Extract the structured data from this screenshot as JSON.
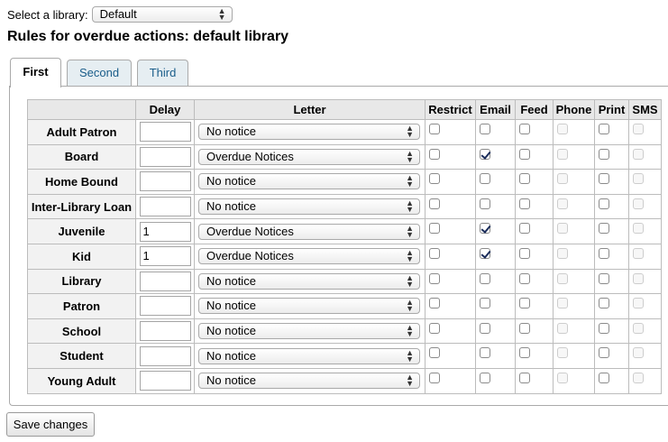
{
  "library_select": {
    "label": "Select a library:",
    "value": "Default"
  },
  "page_title": "Rules for overdue actions: default library",
  "tabs": [
    {
      "label": "First",
      "active": true
    },
    {
      "label": "Second",
      "active": false
    },
    {
      "label": "Third",
      "active": false
    }
  ],
  "table": {
    "headers": {
      "delay": "Delay",
      "letter": "Letter",
      "restrict": "Restrict",
      "email": "Email",
      "feed": "Feed",
      "phone": "Phone",
      "print": "Print",
      "sms": "SMS"
    },
    "rows": [
      {
        "category": "Adult Patron",
        "delay": "",
        "letter": "No notice",
        "restrict": false,
        "email": false,
        "feed": false,
        "phone": false,
        "print": false,
        "sms": false
      },
      {
        "category": "Board",
        "delay": "",
        "letter": "Overdue Notices",
        "restrict": false,
        "email": true,
        "feed": false,
        "phone": false,
        "print": false,
        "sms": false
      },
      {
        "category": "Home Bound",
        "delay": "",
        "letter": "No notice",
        "restrict": false,
        "email": false,
        "feed": false,
        "phone": false,
        "print": false,
        "sms": false
      },
      {
        "category": "Inter-Library Loan",
        "delay": "",
        "letter": "No notice",
        "restrict": false,
        "email": false,
        "feed": false,
        "phone": false,
        "print": false,
        "sms": false
      },
      {
        "category": "Juvenile",
        "delay": "1",
        "letter": "Overdue Notices",
        "restrict": false,
        "email": true,
        "feed": false,
        "phone": false,
        "print": false,
        "sms": false
      },
      {
        "category": "Kid",
        "delay": "1",
        "letter": "Overdue Notices",
        "restrict": false,
        "email": true,
        "feed": false,
        "phone": false,
        "print": false,
        "sms": false
      },
      {
        "category": "Library",
        "delay": "",
        "letter": "No notice",
        "restrict": false,
        "email": false,
        "feed": false,
        "phone": false,
        "print": false,
        "sms": false
      },
      {
        "category": "Patron",
        "delay": "",
        "letter": "No notice",
        "restrict": false,
        "email": false,
        "feed": false,
        "phone": false,
        "print": false,
        "sms": false
      },
      {
        "category": "School",
        "delay": "",
        "letter": "No notice",
        "restrict": false,
        "email": false,
        "feed": false,
        "phone": false,
        "print": false,
        "sms": false
      },
      {
        "category": "Student",
        "delay": "",
        "letter": "No notice",
        "restrict": false,
        "email": false,
        "feed": false,
        "phone": false,
        "print": false,
        "sms": false
      },
      {
        "category": "Young Adult",
        "delay": "",
        "letter": "No notice",
        "restrict": false,
        "email": false,
        "feed": false,
        "phone": false,
        "print": false,
        "sms": false
      }
    ]
  },
  "save_button": "Save changes"
}
